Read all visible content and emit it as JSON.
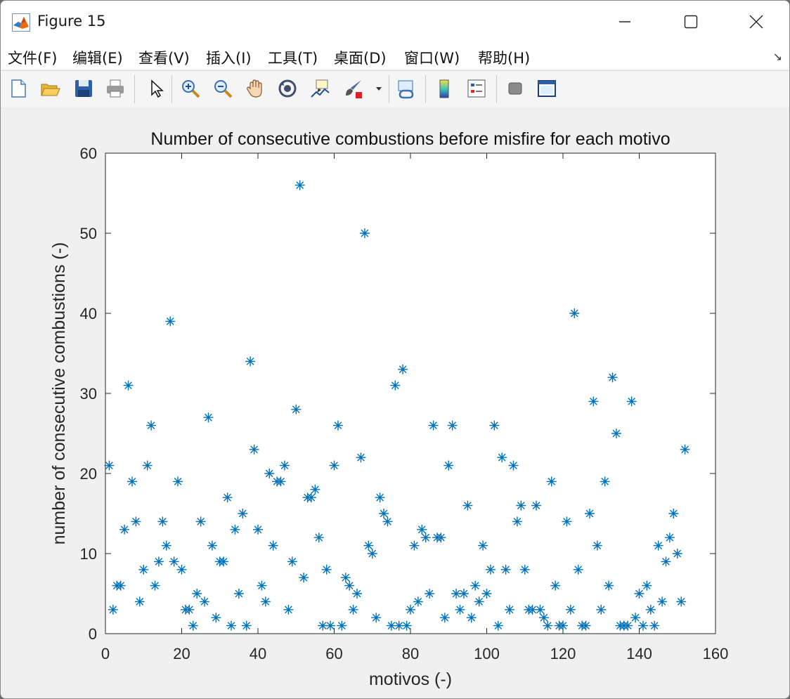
{
  "window": {
    "title": "Figure 15"
  },
  "menu": {
    "items": [
      "文件(F)",
      "编辑(E)",
      "查看(V)",
      "插入(I)",
      "工具(T)",
      "桌面(D)",
      "窗口(W)",
      "帮助(H)"
    ]
  },
  "toolbar": {
    "icons": [
      "new-figure-icon",
      "open-file-icon",
      "save-icon",
      "print-icon",
      "pointer-icon",
      "zoom-in-icon",
      "zoom-out-icon",
      "pan-hand-icon",
      "rotate-3d-icon",
      "data-cursor-icon",
      "brush-icon",
      "brush-dropdown-icon",
      "link-plot-icon",
      "colorbar-icon",
      "legend-icon",
      "hide-plot-tools-icon",
      "show-plot-tools-icon"
    ]
  },
  "colors": {
    "marker": "#0072BD",
    "axes_background": "#ffffff",
    "figure_background": "#f0f0f0"
  },
  "chart_data": {
    "type": "scatter",
    "marker": "*",
    "title": "Number of consecutive combustions before misfire for each motivo",
    "xlabel": "motivos (-)",
    "ylabel": "number of consecutive combustions (-)",
    "xlim": [
      0,
      160
    ],
    "ylim": [
      0,
      60
    ],
    "xticks": [
      0,
      20,
      40,
      60,
      80,
      100,
      120,
      140,
      160
    ],
    "yticks": [
      0,
      10,
      20,
      30,
      40,
      50,
      60
    ],
    "grid": false,
    "x": [
      1,
      2,
      3,
      4,
      5,
      6,
      7,
      8,
      9,
      10,
      11,
      12,
      13,
      14,
      15,
      16,
      17,
      18,
      19,
      20,
      21,
      22,
      23,
      24,
      25,
      26,
      27,
      28,
      29,
      30,
      31,
      32,
      33,
      34,
      35,
      36,
      37,
      38,
      39,
      40,
      41,
      42,
      43,
      44,
      45,
      46,
      47,
      48,
      49,
      50,
      51,
      52,
      53,
      54,
      55,
      56,
      57,
      58,
      59,
      60,
      61,
      62,
      63,
      64,
      65,
      66,
      67,
      68,
      69,
      70,
      71,
      72,
      73,
      74,
      75,
      76,
      77,
      78,
      79,
      80,
      81,
      82,
      83,
      84,
      85,
      86,
      87,
      88,
      89,
      90,
      91,
      92,
      93,
      94,
      95,
      96,
      97,
      98,
      99,
      100,
      101,
      102,
      103,
      104,
      105,
      106,
      107,
      108,
      109,
      110,
      111,
      112,
      113,
      114,
      115,
      116,
      117,
      118,
      119,
      120,
      121,
      122,
      123,
      124,
      125,
      126,
      127,
      128,
      129,
      130,
      131,
      132,
      133,
      134,
      135,
      136,
      137,
      138,
      139,
      140,
      141,
      142,
      143,
      144,
      145,
      146,
      147,
      148,
      149,
      150,
      151,
      152
    ],
    "y": [
      21,
      3,
      6,
      6,
      13,
      31,
      19,
      14,
      4,
      8,
      21,
      26,
      6,
      9,
      14,
      11,
      39,
      9,
      19,
      8,
      3,
      3,
      1,
      5,
      14,
      4,
      27,
      11,
      2,
      9,
      9,
      17,
      1,
      13,
      5,
      15,
      1,
      34,
      23,
      13,
      6,
      4,
      20,
      11,
      19,
      19,
      21,
      3,
      9,
      28,
      56,
      7,
      17,
      17,
      18,
      12,
      1,
      8,
      1,
      21,
      26,
      1,
      7,
      6,
      3,
      5,
      22,
      50,
      11,
      10,
      2,
      17,
      15,
      14,
      1,
      31,
      1,
      33,
      1,
      3,
      11,
      4,
      13,
      12,
      5,
      26,
      12,
      12,
      2,
      21,
      26,
      5,
      3,
      5,
      16,
      2,
      6,
      4,
      11,
      5,
      8,
      26,
      1,
      22,
      8,
      3,
      21,
      14,
      16,
      8,
      3,
      3,
      16,
      3,
      2,
      1,
      19,
      6,
      1,
      1,
      14,
      3,
      40,
      8,
      1,
      1,
      15,
      29,
      11,
      3,
      19,
      6,
      32,
      25,
      1,
      1,
      1,
      29,
      2,
      5,
      1,
      6,
      3,
      1,
      11,
      4,
      9,
      12,
      15,
      10,
      4,
      23
    ]
  }
}
